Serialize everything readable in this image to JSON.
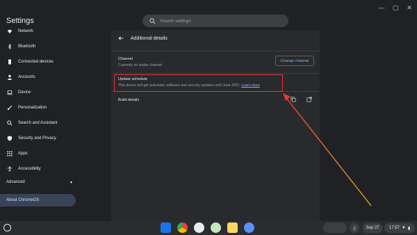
{
  "window": {
    "title": "Settings",
    "controls": [
      "minimize-icon",
      "maximize-icon",
      "close-icon"
    ]
  },
  "search": {
    "placeholder": "Search settings"
  },
  "sidebar": {
    "items": [
      {
        "label": "Network",
        "icon": "wifi-icon"
      },
      {
        "label": "Bluetooth",
        "icon": "bluetooth-icon"
      },
      {
        "label": "Connected devices",
        "icon": "phone-icon"
      },
      {
        "label": "Accounts",
        "icon": "person-icon"
      },
      {
        "label": "Device",
        "icon": "laptop-icon"
      },
      {
        "label": "Personalization",
        "icon": "brush-icon"
      },
      {
        "label": "Search and Assistant",
        "icon": "search-icon"
      },
      {
        "label": "Security and Privacy",
        "icon": "shield-icon"
      },
      {
        "label": "Apps",
        "icon": "grid-icon"
      },
      {
        "label": "Accessibility",
        "icon": "accessibility-icon"
      }
    ],
    "advanced": "Advanced",
    "about": "About ChromeOS"
  },
  "main": {
    "title": "Additional details",
    "channel": {
      "label": "Channel",
      "sub": "Currently on stable channel",
      "button": "Change channel"
    },
    "update": {
      "label": "Update schedule",
      "text": "This device will get automatic software and security updates until June 2031.",
      "link": "Learn more"
    },
    "build": {
      "label": "Build details"
    }
  },
  "shelf": {
    "date": "Sep 27",
    "time": "17:57"
  },
  "colors": {
    "accent": "#8ab4f8",
    "highlight": "#e53935",
    "background": "#202124",
    "card": "#292a2d"
  }
}
